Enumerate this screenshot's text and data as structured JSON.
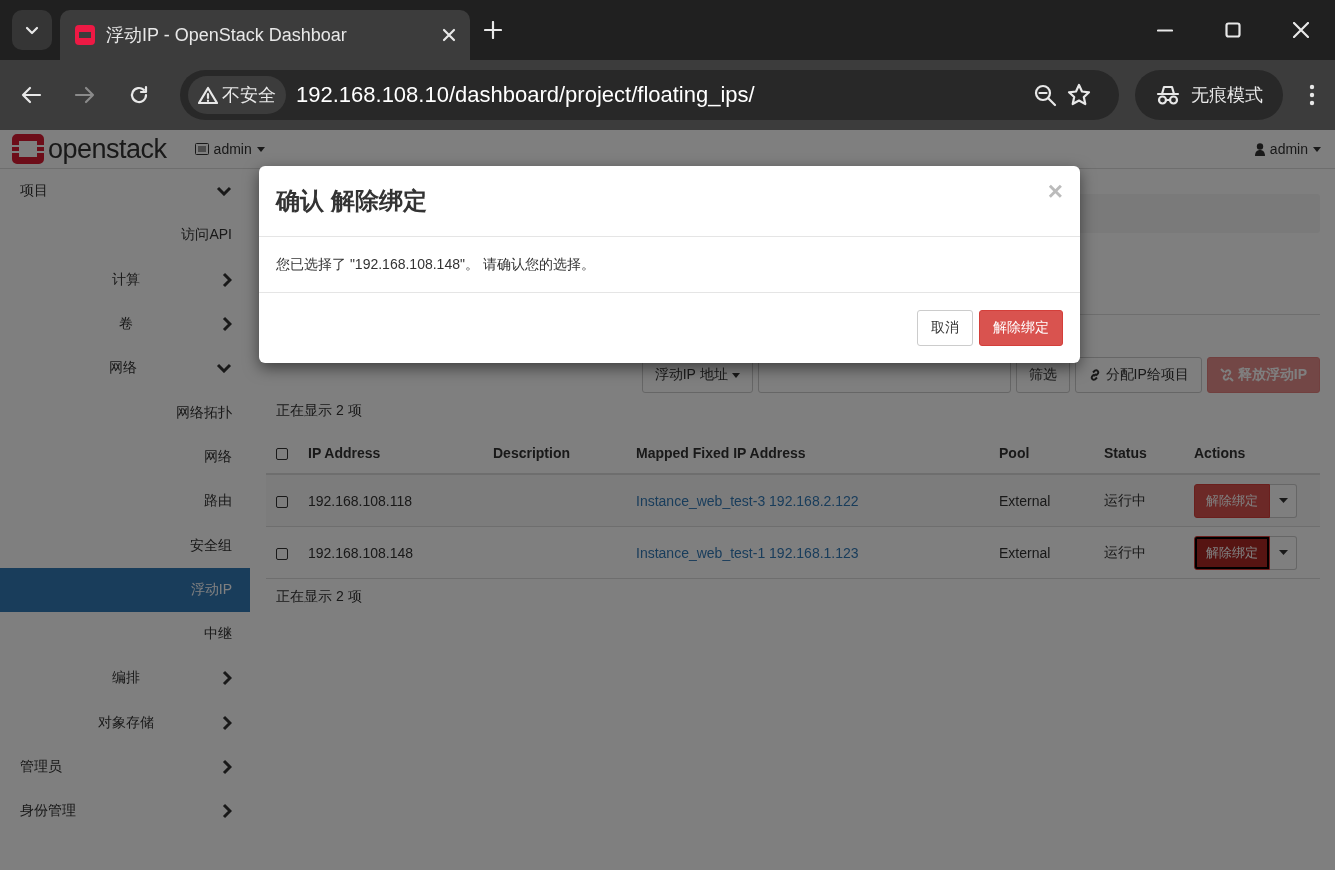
{
  "browser": {
    "tab_title": "浮动IP - OpenStack Dashboar",
    "address": "192.168.108.10/dashboard/project/floating_ips/",
    "security_label": "不安全",
    "incognito_label": "无痕模式"
  },
  "header": {
    "logo_text": "openstack",
    "project": "admin",
    "user": "admin"
  },
  "sidebar": {
    "items": [
      {
        "label": "项目",
        "kind": "group",
        "expanded": true,
        "children": [
          {
            "label": "访问API",
            "kind": "link",
            "selected": false
          },
          {
            "label": "计算",
            "kind": "group",
            "expanded": false
          },
          {
            "label": "卷",
            "kind": "group",
            "expanded": false
          },
          {
            "label": "网络",
            "kind": "group",
            "expanded": true,
            "children": [
              {
                "label": "网络拓扑",
                "kind": "link",
                "selected": false
              },
              {
                "label": "网络",
                "kind": "link",
                "selected": false
              },
              {
                "label": "路由",
                "kind": "link",
                "selected": false
              },
              {
                "label": "安全组",
                "kind": "link",
                "selected": false
              },
              {
                "label": "浮动IP",
                "kind": "link",
                "selected": true
              },
              {
                "label": "中继",
                "kind": "link",
                "selected": false
              }
            ]
          },
          {
            "label": "编排",
            "kind": "group",
            "expanded": false
          },
          {
            "label": "对象存储",
            "kind": "group",
            "expanded": false
          }
        ]
      },
      {
        "label": "管理员",
        "kind": "group",
        "expanded": false
      },
      {
        "label": "身份管理",
        "kind": "group",
        "expanded": false
      }
    ]
  },
  "toolbar": {
    "filter_field": "浮动IP 地址",
    "filter_button": "筛选",
    "allocate_button": "分配IP给项目",
    "release_button": {
      "label": "释放浮动IP",
      "disabled": true
    }
  },
  "table": {
    "count_top": "正在显示 2 项",
    "count_bottom": "正在显示 2 项",
    "select_all_checked": false,
    "columns": [
      "IP Address",
      "Description",
      "Mapped Fixed IP Address",
      "Pool",
      "Status",
      "Actions"
    ],
    "rows": [
      {
        "checked": false,
        "ip": "192.168.108.118",
        "mapped": "Instance_web_test-3 192.168.2.122",
        "pool": "External",
        "status": "运行中",
        "action": "解除绑定",
        "focused": false
      },
      {
        "checked": false,
        "ip": "192.168.108.148",
        "mapped": "Instance_web_test-1 192.168.1.123",
        "pool": "External",
        "status": "运行中",
        "action": "解除绑定",
        "focused": true
      }
    ]
  },
  "modal": {
    "title": "确认 解除绑定",
    "close": "×",
    "message": "您已选择了 \"192.168.108.148\"。 请确认您的选择。",
    "cancel": "取消",
    "confirm": "解除绑定"
  }
}
